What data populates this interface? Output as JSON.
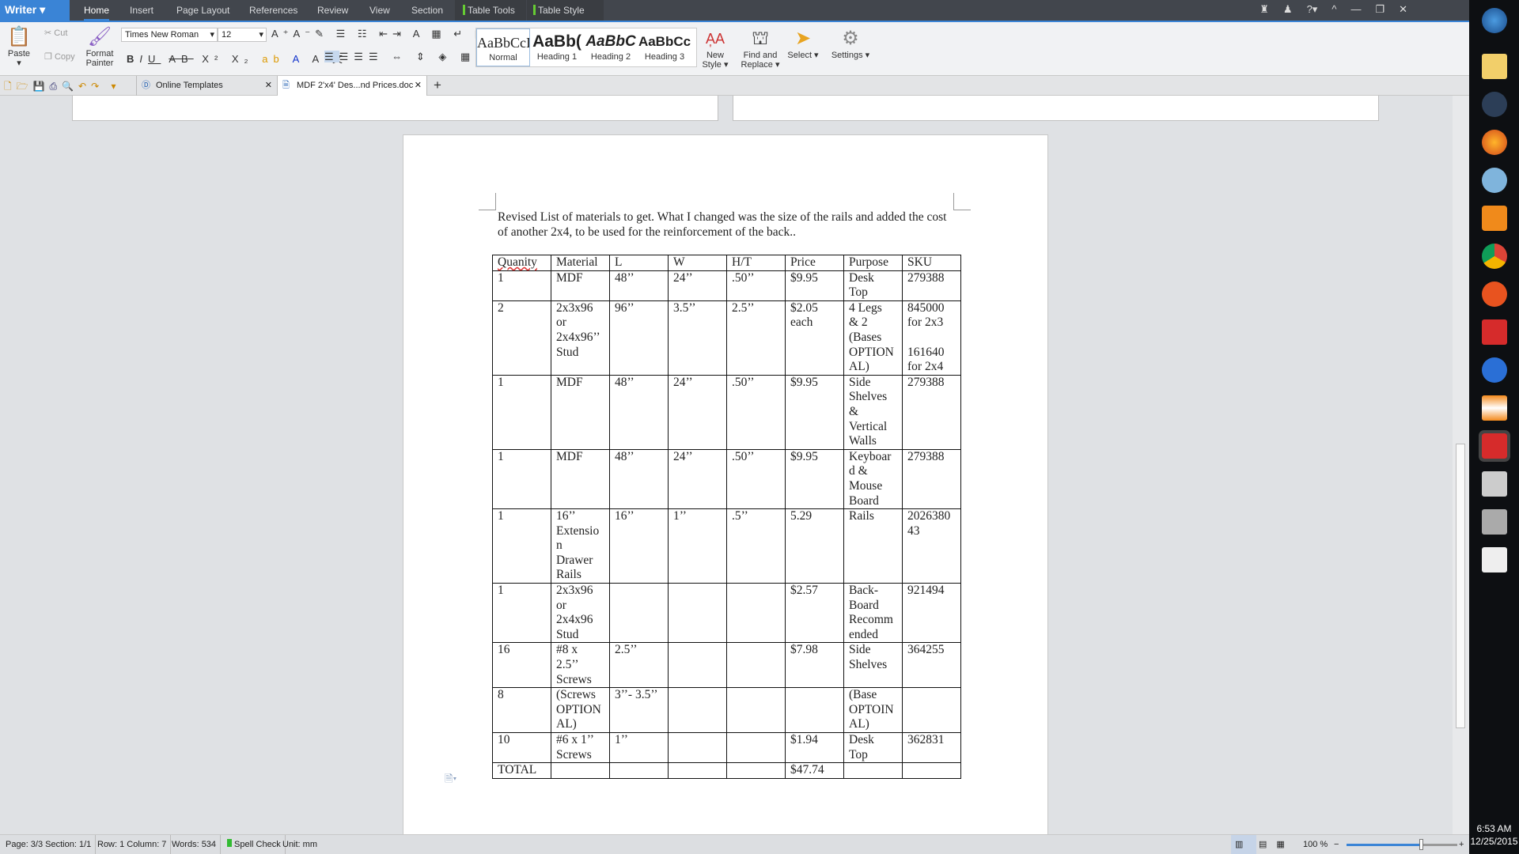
{
  "app": {
    "name": "Writer",
    "menu_tabs": [
      "Home",
      "Insert",
      "Page Layout",
      "References",
      "Review",
      "View",
      "Section"
    ],
    "context_tabs": [
      "Table Tools",
      "Table Style"
    ],
    "accent": "#3a84d6"
  },
  "ribbon": {
    "paste": "Paste",
    "cut": "Cut",
    "copy": "Copy",
    "format_painter": "Format Painter",
    "font": "Times New Roman",
    "size": "12",
    "styles": [
      {
        "preview": "AaBbCcI",
        "name": "Normal"
      },
      {
        "preview": "AaBb(",
        "name": "Heading 1"
      },
      {
        "preview": "AaBbC",
        "name": "Heading 2"
      },
      {
        "preview": "AaBbCc",
        "name": "Heading 3"
      }
    ],
    "new_style": "New Style",
    "find_replace": "Find and Replace",
    "select": "Select",
    "settings": "Settings"
  },
  "doc_tabs": [
    {
      "label": "Online Templates"
    },
    {
      "label": "MDF 2'x4' Des...nd Prices.doc"
    }
  ],
  "document": {
    "intro": "Revised List of materials to get. What I changed was the size of the rails and added the cost of another 2x4, to be used for the reinforcement of the back..",
    "table": {
      "headers": [
        "Quanity",
        "Material",
        "L",
        "W",
        "H/T",
        "Price",
        "Purpose",
        "SKU"
      ],
      "rows": [
        [
          "1",
          "MDF",
          "48’’",
          "24’’",
          ".50’’",
          "$9.95",
          "Desk\nTop",
          "279388"
        ],
        [
          "2",
          "2x3x96\nor\n2x4x96’’\nStud",
          "96’’",
          "3.5’’",
          "2.5’’",
          "$2.05\neach",
          "4 Legs\n& 2\n(Bases\nOPTION\nAL)",
          "845000\nfor 2x3\n\n161640\nfor 2x4"
        ],
        [
          "1",
          "MDF",
          "48’’",
          "24’’",
          ".50’’",
          "$9.95",
          "Side\nShelves\n&\nVertical\nWalls",
          "279388"
        ],
        [
          "1",
          "MDF",
          "48’’",
          "24’’",
          ".50’’",
          "$9.95",
          "Keyboar\nd &\nMouse\nBoard",
          "279388"
        ],
        [
          "1",
          "16’’\nExtensio\nn\nDrawer\nRails",
          "16’’",
          "1’’",
          ".5’’",
          "5.29",
          "Rails",
          "2026380\n43"
        ],
        [
          "1",
          "2x3x96\nor\n2x4x96\nStud",
          "",
          "",
          "",
          "$2.57",
          "Back-\nBoard\nRecomm\nended",
          "921494"
        ],
        [
          "16",
          "#8 x\n2.5’’\nScrews",
          "2.5’’",
          "",
          "",
          "$7.98",
          "Side\nShelves",
          "364255"
        ],
        [
          "8",
          "(Screws\nOPTION\nAL)",
          "3’’- 3.5’’",
          "",
          "",
          "",
          "(Base\nOPTOIN\nAL)",
          ""
        ],
        [
          "10",
          "#6 x 1’’\nScrews",
          "1’’",
          "",
          "",
          "$1.94",
          "Desk\nTop",
          "362831"
        ],
        [
          "TOTAL",
          "",
          "",
          "",
          "",
          "$47.74",
          "",
          ""
        ]
      ]
    }
  },
  "status": {
    "page": "Page: 3/3 Section: 1/1",
    "rowcol": "Row: 1 Column: 7",
    "words": "Words: 534",
    "spell": "Spell Check",
    "unit": "Unit: mm",
    "zoom": "100 %"
  },
  "taskbar": {
    "time": "6:53 AM",
    "date": "12/25/2015"
  }
}
